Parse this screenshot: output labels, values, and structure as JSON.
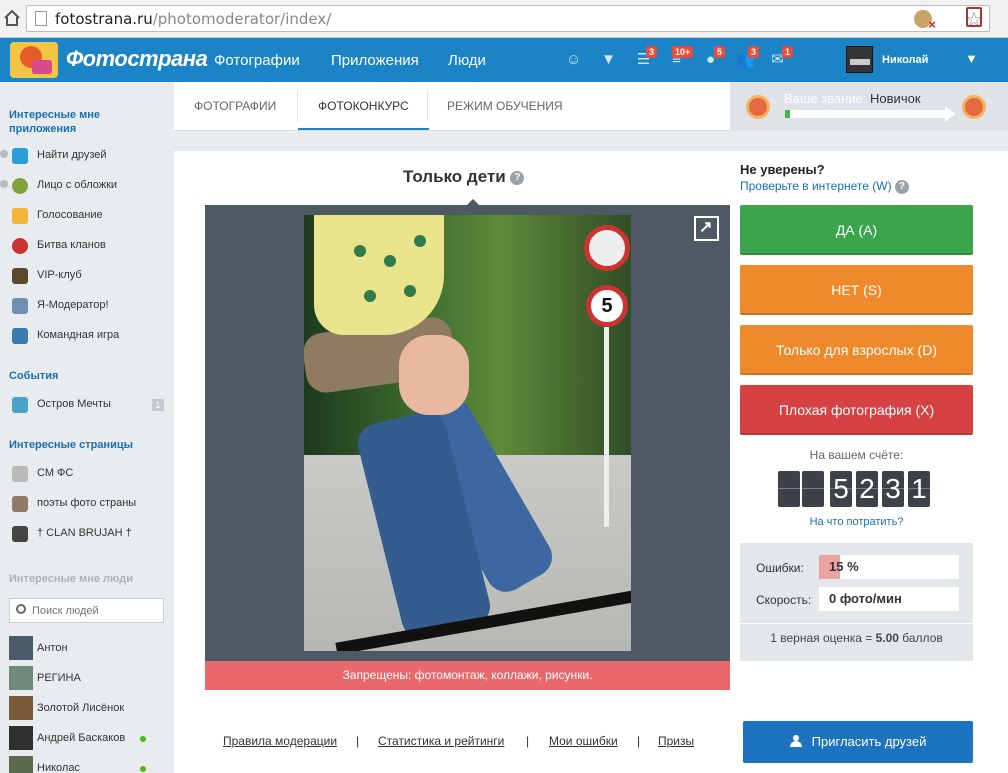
{
  "browser": {
    "url_host": "fotostrana.ru",
    "url_path": "/photomoderator/index/"
  },
  "header": {
    "logo": "Фотострана",
    "nav": [
      "Фотографии",
      "Приложения",
      "Люди"
    ],
    "badges": [
      "3",
      "10+",
      "5",
      "3",
      "1"
    ],
    "user_name": "Николай",
    "brand_color": "#1b84c6"
  },
  "sidebar": {
    "apps_heading": "Интересные мне приложения",
    "apps": [
      {
        "label": "Найти друзей",
        "icon": "find-friends-icon"
      },
      {
        "label": "Лицо с обложки",
        "icon": "cover-face-icon"
      },
      {
        "label": "Голосование",
        "icon": "crown-icon"
      },
      {
        "label": "Битва кланов",
        "icon": "clan-battle-icon"
      },
      {
        "label": "VIP-клуб",
        "icon": "vip-icon"
      },
      {
        "label": "Я-Модератор!",
        "icon": "moderator-icon"
      },
      {
        "label": "Командная игра",
        "icon": "team-game-icon"
      }
    ],
    "events_heading": "События",
    "events": [
      {
        "label": "Остров Мечты",
        "count": "1"
      }
    ],
    "pages_heading": "Интересные страницы",
    "pages": [
      {
        "label": "СМ ФС"
      },
      {
        "label": "поэты фото страны"
      },
      {
        "label": "† CLAN BRUJAH †"
      }
    ],
    "people_heading": "Интересные мне люди",
    "search_placeholder": "Поиск людей",
    "people": [
      {
        "name": "Антон",
        "online": false
      },
      {
        "name": "РЕГИНА",
        "online": false
      },
      {
        "name": "Золотой Лисёнок",
        "online": false
      },
      {
        "name": "Андрей Баскаков",
        "online": true
      },
      {
        "name": "Николас",
        "online": true
      }
    ]
  },
  "tabs": [
    "Фотографии",
    "Фотоконкурс",
    "Режим обучения"
  ],
  "active_tab": "Фотоконкурс",
  "rank": {
    "prefix": "Ваше звание:",
    "value": "Новичок",
    "progress": 0.03
  },
  "contest": {
    "title": "Только дети",
    "help": "?",
    "sign_number": "5",
    "restriction": "Запрещены: фотомонтаж, коллажи, рисунки."
  },
  "moderation": {
    "unsure_title": "Не уверены?",
    "check_link": "Проверьте в интернете (W)",
    "buttons": [
      {
        "label": "ДА (A)",
        "color": "#3aa54a"
      },
      {
        "label": "НЕТ (S)",
        "color": "#ee8a2b"
      },
      {
        "label": "Только для взрослых (D)",
        "color": "#ee8a2b"
      },
      {
        "label": "Плохая фотография (X)",
        "color": "#d64243"
      }
    ],
    "score_label": "На вашем счёте:",
    "score_digits": [
      "",
      "",
      "5",
      "2",
      "3",
      "1"
    ],
    "spend_link": "На что потратить?",
    "errors_label": "Ошибки:",
    "errors_value": "15 %",
    "errors_fraction": 0.15,
    "speed_label": "Скорость:",
    "speed_value": "0 фото/мин",
    "note_prefix": "1 верная оценка =",
    "note_value": "5.00",
    "note_suffix": "баллов"
  },
  "footer": {
    "links": [
      "Правила модерации",
      "Статистика и рейтинги",
      "Мои ошибки",
      "Призы"
    ],
    "separator": "|",
    "invite": "Пригласить друзей"
  }
}
